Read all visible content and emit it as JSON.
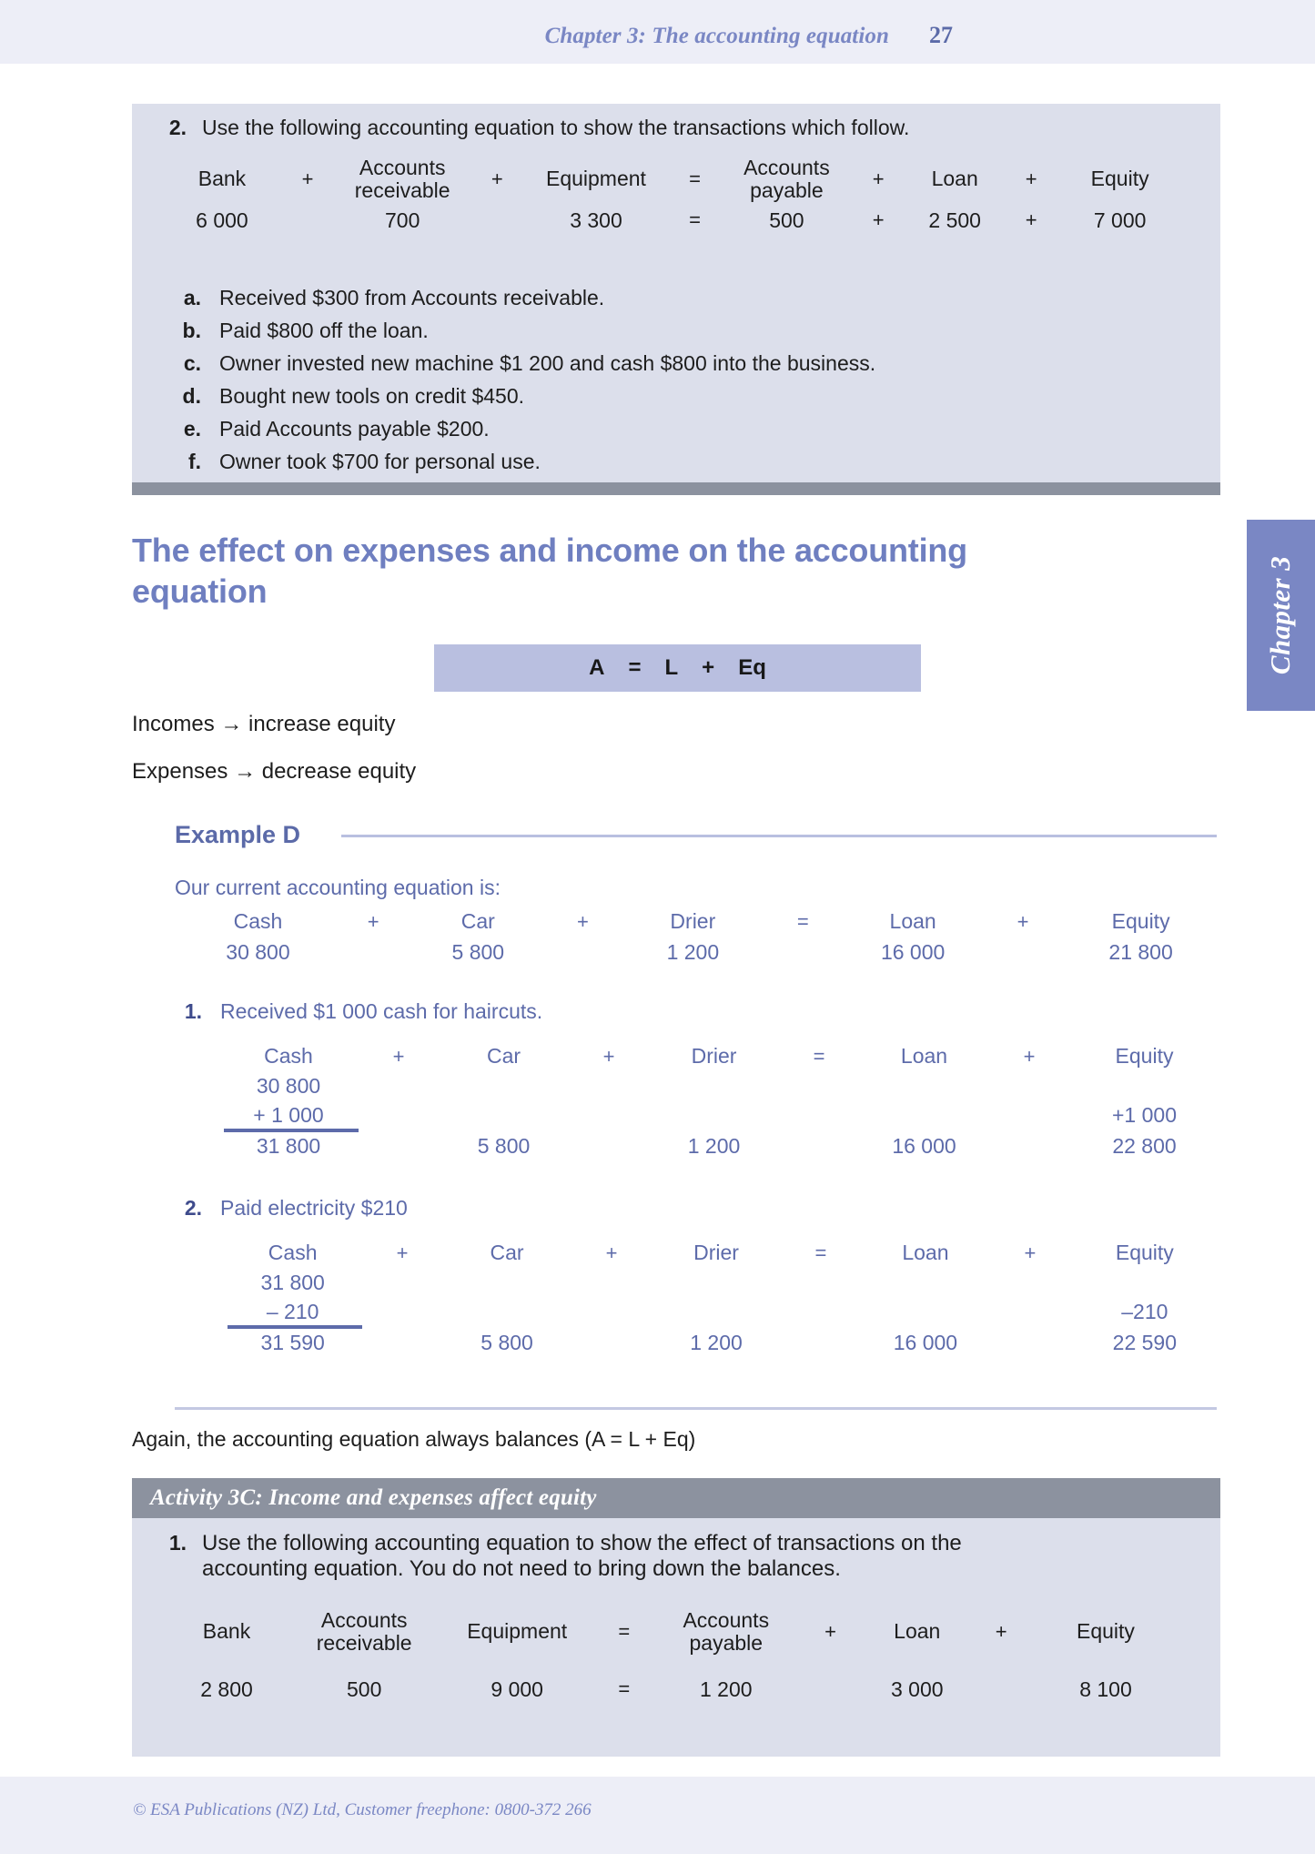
{
  "header": {
    "title": "Chapter 3: The accounting equation",
    "page_number": "27"
  },
  "chapter_tab": {
    "label": "Chapter 3"
  },
  "activity_top": {
    "number": "2.",
    "prompt": "Use the following accounting equation to show the transactions which follow.",
    "equation": {
      "headers": [
        "Bank",
        "+",
        "Accounts receivable",
        "+",
        "Equipment",
        "=",
        "Accounts payable",
        "+",
        "Loan",
        "+",
        "Equity"
      ],
      "header_cells": [
        {
          "text": "Bank",
          "type": "label"
        },
        {
          "text": "+",
          "type": "op"
        },
        {
          "line1": "Accounts",
          "line2": "receivable",
          "type": "label2"
        },
        {
          "text": "+",
          "type": "op"
        },
        {
          "text": "Equipment",
          "type": "label"
        },
        {
          "text": "=",
          "type": "op"
        },
        {
          "line1": "Accounts",
          "line2": "payable",
          "type": "label2"
        },
        {
          "text": "+",
          "type": "op"
        },
        {
          "text": "Loan",
          "type": "label"
        },
        {
          "text": "+",
          "type": "op"
        },
        {
          "text": "Equity",
          "type": "label"
        }
      ],
      "values": [
        "6 000",
        "",
        "700",
        "",
        "3 300",
        "=",
        "500",
        "+",
        "2 500",
        "+",
        "7 000"
      ]
    },
    "items": [
      {
        "marker": "a.",
        "text": "Received $300 from Accounts receivable."
      },
      {
        "marker": "b.",
        "text": "Paid $800 off the loan."
      },
      {
        "marker": "c.",
        "text": "Owner invested new machine $1 200 and cash $800 into the business."
      },
      {
        "marker": "d.",
        "text": "Bought new tools on credit $450."
      },
      {
        "marker": "e.",
        "text": "Paid Accounts payable $200."
      },
      {
        "marker": "f.",
        "text": "Owner took $700 for personal use."
      }
    ]
  },
  "section": {
    "heading_line1": "The effect on expenses and income on the accounting",
    "heading_line2": "equation",
    "formula_bar": [
      "A",
      "=",
      "L",
      "+",
      "Eq"
    ],
    "rules": [
      "Incomes → increase equity",
      "Expenses → decrease equity"
    ]
  },
  "example": {
    "label": "Example D",
    "intro": "Our current accounting equation is:",
    "current_equation": {
      "headers": [
        "Cash",
        "+",
        "Car",
        "+",
        "Drier",
        "=",
        "Loan",
        "+",
        "Equity"
      ],
      "values": [
        "30 800",
        "",
        "5 800",
        "",
        "1 200",
        "",
        "16 000",
        "",
        "21 800"
      ]
    },
    "transactions": [
      {
        "number": "1.",
        "description": "Received $1 000 cash for haircuts.",
        "headers": [
          "Cash",
          "+",
          "Car",
          "+",
          "Drier",
          "=",
          "Loan",
          "+",
          "Equity"
        ],
        "opening": [
          "30 800",
          "",
          "",
          "",
          "",
          "",
          "",
          "",
          ""
        ],
        "change": [
          "+ 1 000",
          "",
          "",
          "",
          "",
          "",
          "",
          "",
          "+1 000"
        ],
        "rule_columns": [
          0
        ],
        "closing": [
          "31 800",
          "",
          "5 800",
          "",
          "1 200",
          "",
          "16 000",
          "",
          "22 800"
        ]
      },
      {
        "number": "2.",
        "description": "Paid electricity $210",
        "headers": [
          "Cash",
          "+",
          "Car",
          "+",
          "Drier",
          "=",
          "Loan",
          "+",
          "Equity"
        ],
        "opening": [
          "31 800",
          "",
          "",
          "",
          "",
          "",
          "",
          "",
          ""
        ],
        "change": [
          "–   210",
          "",
          "",
          "",
          "",
          "",
          "",
          "",
          "–210"
        ],
        "rule_columns": [
          0
        ],
        "closing": [
          "31 590",
          "",
          "5 800",
          "",
          "1 200",
          "",
          "16 000",
          "",
          "22 590"
        ]
      }
    ],
    "closing_note": "Again, the accounting equation always balances (A = L + Eq)"
  },
  "activity_bottom": {
    "title": "Activity 3C: Income and expenses affect equity",
    "number": "1.",
    "prompt_line1": "Use the following accounting equation to show the effect of transactions on the",
    "prompt_line2": "accounting equation. You do not need to bring down the balances.",
    "equation": {
      "header_cells": [
        {
          "text": "Bank",
          "type": "label"
        },
        {
          "line1": "Accounts",
          "line2": "receivable",
          "type": "label2"
        },
        {
          "text": "Equipment",
          "type": "label"
        },
        {
          "text": "=",
          "type": "op"
        },
        {
          "line1": "Accounts",
          "line2": "payable",
          "type": "label2"
        },
        {
          "text": "+",
          "type": "op"
        },
        {
          "text": "Loan",
          "type": "label"
        },
        {
          "text": "+",
          "type": "op"
        },
        {
          "text": "Equity",
          "type": "label"
        }
      ],
      "values": [
        "2 800",
        "500",
        "9 000",
        "=",
        "1 200",
        "",
        "3 000",
        "",
        "8 100"
      ]
    }
  },
  "footer": {
    "copyright": "© ESA Publications (NZ) Ltd, Customer freephone: 0800-372 266"
  }
}
